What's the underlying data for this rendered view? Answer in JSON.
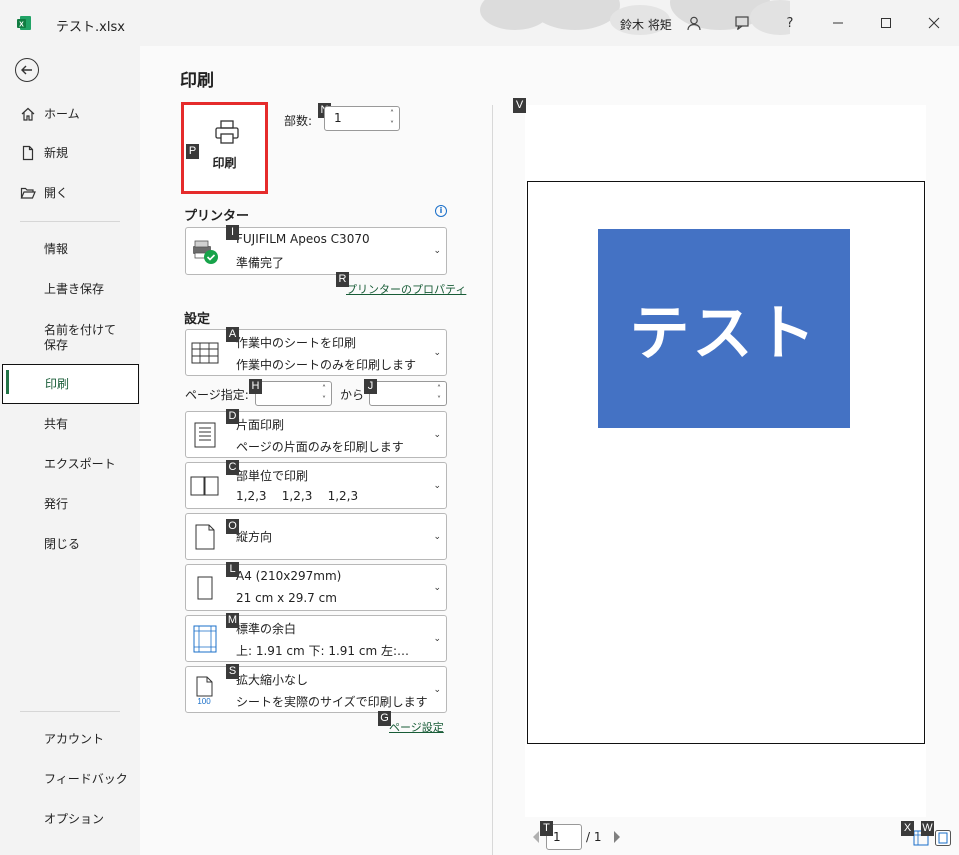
{
  "titlebar": {
    "doc_title": "テスト.xlsx",
    "user_name": "鈴木 将矩",
    "help_label": "?"
  },
  "sidebar": {
    "items": [
      {
        "label": "ホーム",
        "icon": "home-icon"
      },
      {
        "label": "新規",
        "icon": "new-document-icon"
      },
      {
        "label": "開く",
        "icon": "open-folder-icon"
      },
      {
        "label": "情報"
      },
      {
        "label": "上書き保存"
      },
      {
        "label": "名前を付けて保存"
      },
      {
        "label": "印刷",
        "selected": true
      },
      {
        "label": "共有"
      },
      {
        "label": "エクスポート"
      },
      {
        "label": "発行"
      },
      {
        "label": "閉じる"
      }
    ],
    "bottom_items": [
      {
        "label": "アカウント"
      },
      {
        "label": "フィードバック"
      },
      {
        "label": "オプション"
      }
    ]
  },
  "main": {
    "title": "印刷",
    "print_button_label": "印刷",
    "copies_label": "部数:",
    "copies_value": "1",
    "printer_heading": "プリンター",
    "printer": {
      "name": "FUJIFILM Apeos C3070",
      "status": "準備完了"
    },
    "printer_properties_link": "プリンターのプロパティ",
    "settings_heading": "設定",
    "settings": [
      {
        "key": "A",
        "line1": "作業中のシートを印刷",
        "line2": "作業中のシートのみを印刷します"
      },
      {
        "key": "D",
        "line1": "片面印刷",
        "line2": "ページの片面のみを印刷します"
      },
      {
        "key": "C",
        "line1": "部単位で印刷",
        "line2": "1,2,3    1,2,3    1,2,3"
      },
      {
        "key": "O",
        "line1": "縦方向",
        "line2": ""
      },
      {
        "key": "L",
        "line1": "A4 (210x297mm)",
        "line2": "21 cm x 29.7 cm"
      },
      {
        "key": "M",
        "line1": "標準の余白",
        "line2": "上: 1.91 cm 下: 1.91 cm 左:…"
      },
      {
        "key": "S",
        "line1": "拡大縮小なし",
        "line2": "シートを実際のサイズで印刷します"
      }
    ],
    "pages_label": "ページ指定:",
    "pages_to_label": "から",
    "page_setup_link": "ページ設定"
  },
  "keytips": {
    "print": "P",
    "copies": "N",
    "printer": "I",
    "properties": "R",
    "pages_from": "H",
    "pages_to": "J",
    "page_setup": "G",
    "preview": "V",
    "page_nav": "T",
    "show_margins": "X",
    "zoom_page": "W"
  },
  "preview": {
    "banner_text": "テスト",
    "banner_color": "#4472c4",
    "current_page": "1",
    "total_pages": "/ 1"
  },
  "colors": {
    "accent": "#217346",
    "highlight_border": "#e52b2b",
    "link": "#185c37"
  }
}
